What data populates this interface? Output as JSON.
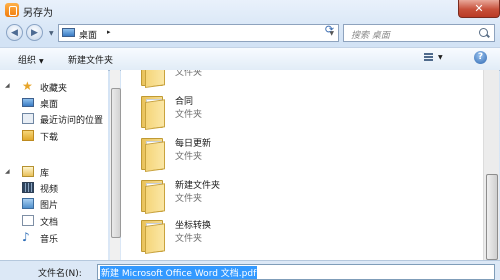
{
  "window": {
    "title": "另存为",
    "close_label": "✕"
  },
  "nav": {
    "back_glyph": "◀",
    "forward_glyph": "▶",
    "address": {
      "location": "桌面",
      "separator": "▸"
    },
    "search_placeholder": "搜索 桌面"
  },
  "toolbar": {
    "organize_label": "组织",
    "new_folder_label": "新建文件夹",
    "help_label": "?"
  },
  "sidebar": {
    "favorites": [
      {
        "label": "收藏夹",
        "icon": "star-icon"
      },
      {
        "label": "桌面",
        "icon": "desktop-icon"
      },
      {
        "label": "最近访问的位置",
        "icon": "recent-places-icon"
      },
      {
        "label": "下载",
        "icon": "downloads-folder-icon"
      }
    ],
    "libraries": [
      {
        "label": "库",
        "icon": "library-icon"
      },
      {
        "label": "视频",
        "icon": "video-library-icon"
      },
      {
        "label": "图片",
        "icon": "pictures-library-icon"
      },
      {
        "label": "文档",
        "icon": "documents-library-icon"
      },
      {
        "label": "音乐",
        "icon": "music-library-icon"
      }
    ]
  },
  "files": [
    {
      "name": "",
      "type": "文件夹"
    },
    {
      "name": "合同",
      "type": "文件夹"
    },
    {
      "name": "每日更新",
      "type": "文件夹"
    },
    {
      "name": "新建文件夹",
      "type": "文件夹"
    },
    {
      "name": "坐标转换",
      "type": "文件夹"
    }
  ],
  "footer": {
    "filename_label": "文件名(N):",
    "filename_value": "新建 Microsoft Office Word 文档.pdf"
  }
}
